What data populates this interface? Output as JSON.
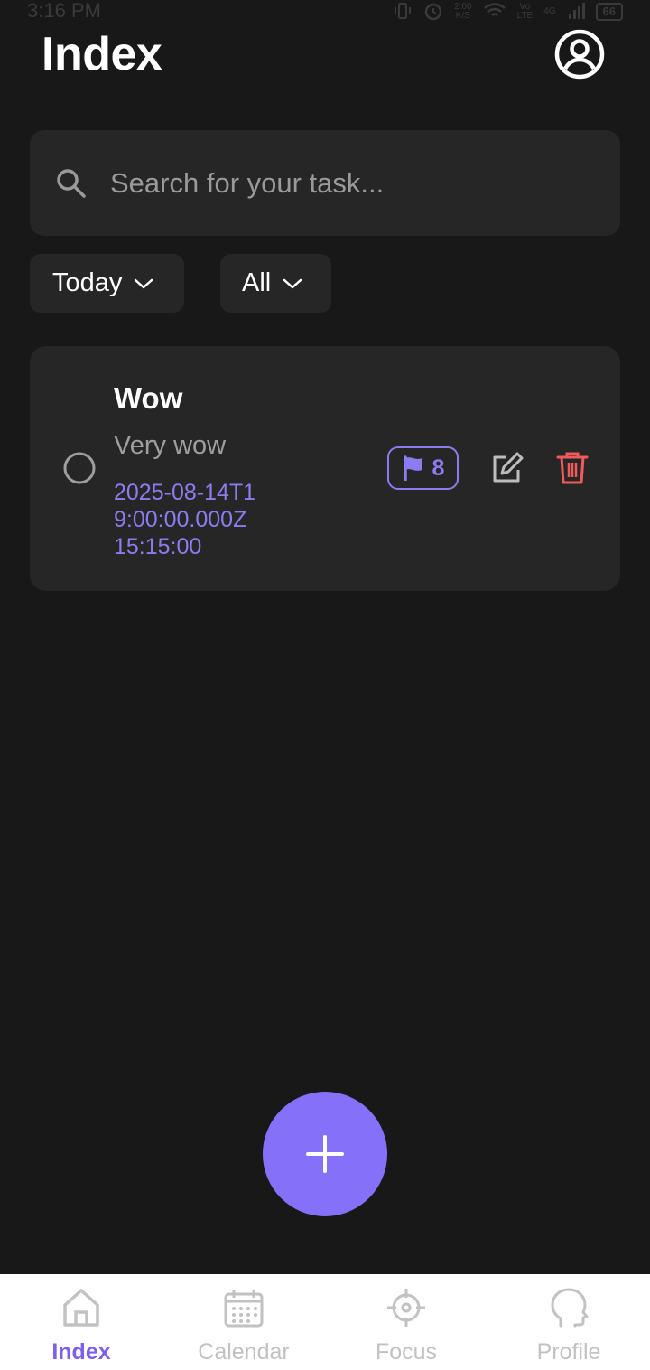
{
  "status_bar": {
    "time": "3:16 PM",
    "net_speed_top": "2.00",
    "net_speed_bottom": "K/S",
    "volte_top": "Vo",
    "volte_bottom": "LTE",
    "network": "4G",
    "battery": "66"
  },
  "header": {
    "title": "Index",
    "profile_icon": "account-circle-icon"
  },
  "search": {
    "placeholder": "Search for your task..."
  },
  "filters": {
    "date_label": "Today",
    "category_label": "All"
  },
  "tasks": [
    {
      "title": "Wow",
      "description": "Very wow",
      "date_line1": "2025-08-14T1",
      "date_line2": "9:00:00.000Z",
      "time": "15:15:00",
      "priority": "8",
      "completed": false
    }
  ],
  "fab": {
    "icon": "plus-icon"
  },
  "bottom_nav": {
    "items": [
      {
        "label": "Index",
        "icon": "home-icon",
        "active": true
      },
      {
        "label": "Calendar",
        "icon": "calendar-icon",
        "active": false
      },
      {
        "label": "Focus",
        "icon": "crosshair-icon",
        "active": false
      },
      {
        "label": "Profile",
        "icon": "head-icon",
        "active": false
      }
    ]
  },
  "colors": {
    "background": "#181818",
    "surface": "#262626",
    "accent": "#8570fa",
    "accent_text": "#8b7cf0",
    "danger": "#f05a5a",
    "nav_active": "#7c5ef0",
    "nav_inactive": "#c2c2c2"
  }
}
